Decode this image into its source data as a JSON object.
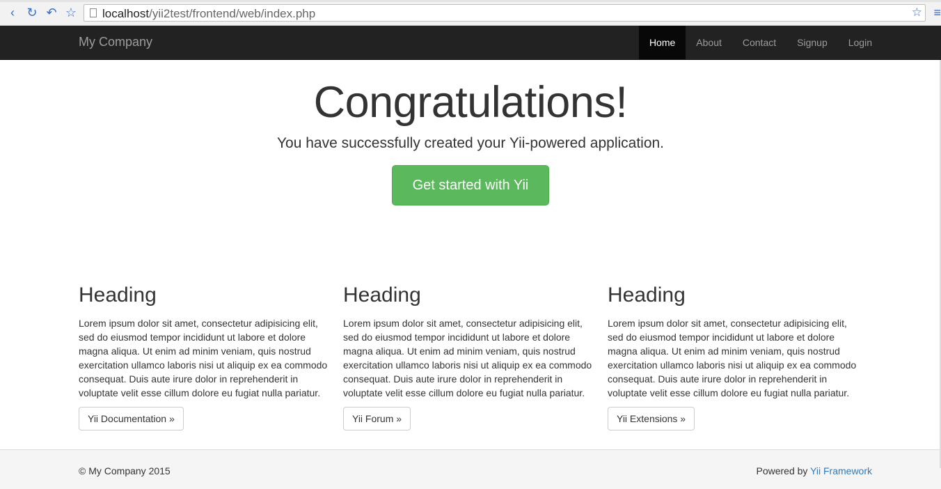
{
  "browser": {
    "url_host": "localhost",
    "url_path": "/yii2test/frontend/web/index.php"
  },
  "navbar": {
    "brand": "My Company",
    "items": [
      {
        "label": "Home",
        "active": true
      },
      {
        "label": "About",
        "active": false
      },
      {
        "label": "Contact",
        "active": false
      },
      {
        "label": "Signup",
        "active": false
      },
      {
        "label": "Login",
        "active": false
      }
    ]
  },
  "jumbotron": {
    "title": "Congratulations!",
    "lead": "You have successfully created your Yii-powered application.",
    "button_label": "Get started with Yii"
  },
  "columns": [
    {
      "heading": "Heading",
      "text": "Lorem ipsum dolor sit amet, consectetur adipisicing elit, sed do eiusmod tempor incididunt ut labore et dolore magna aliqua. Ut enim ad minim veniam, quis nostrud exercitation ullamco laboris nisi ut aliquip ex ea commodo consequat. Duis aute irure dolor in reprehenderit in voluptate velit esse cillum dolore eu fugiat nulla pariatur.",
      "button_label": "Yii Documentation »"
    },
    {
      "heading": "Heading",
      "text": "Lorem ipsum dolor sit amet, consectetur adipisicing elit, sed do eiusmod tempor incididunt ut labore et dolore magna aliqua. Ut enim ad minim veniam, quis nostrud exercitation ullamco laboris nisi ut aliquip ex ea commodo consequat. Duis aute irure dolor in reprehenderit in voluptate velit esse cillum dolore eu fugiat nulla pariatur.",
      "button_label": "Yii Forum »"
    },
    {
      "heading": "Heading",
      "text": "Lorem ipsum dolor sit amet, consectetur adipisicing elit, sed do eiusmod tempor incididunt ut labore et dolore magna aliqua. Ut enim ad minim veniam, quis nostrud exercitation ullamco laboris nisi ut aliquip ex ea commodo consequat. Duis aute irure dolor in reprehenderit in voluptate velit esse cillum dolore eu fugiat nulla pariatur.",
      "button_label": "Yii Extensions »"
    }
  ],
  "footer": {
    "copyright": "© My Company 2015",
    "powered_prefix": "Powered by ",
    "powered_link": "Yii Framework"
  },
  "colors": {
    "navbar_bg": "#222222",
    "success": "#5cb85c",
    "link": "#337ab7"
  }
}
